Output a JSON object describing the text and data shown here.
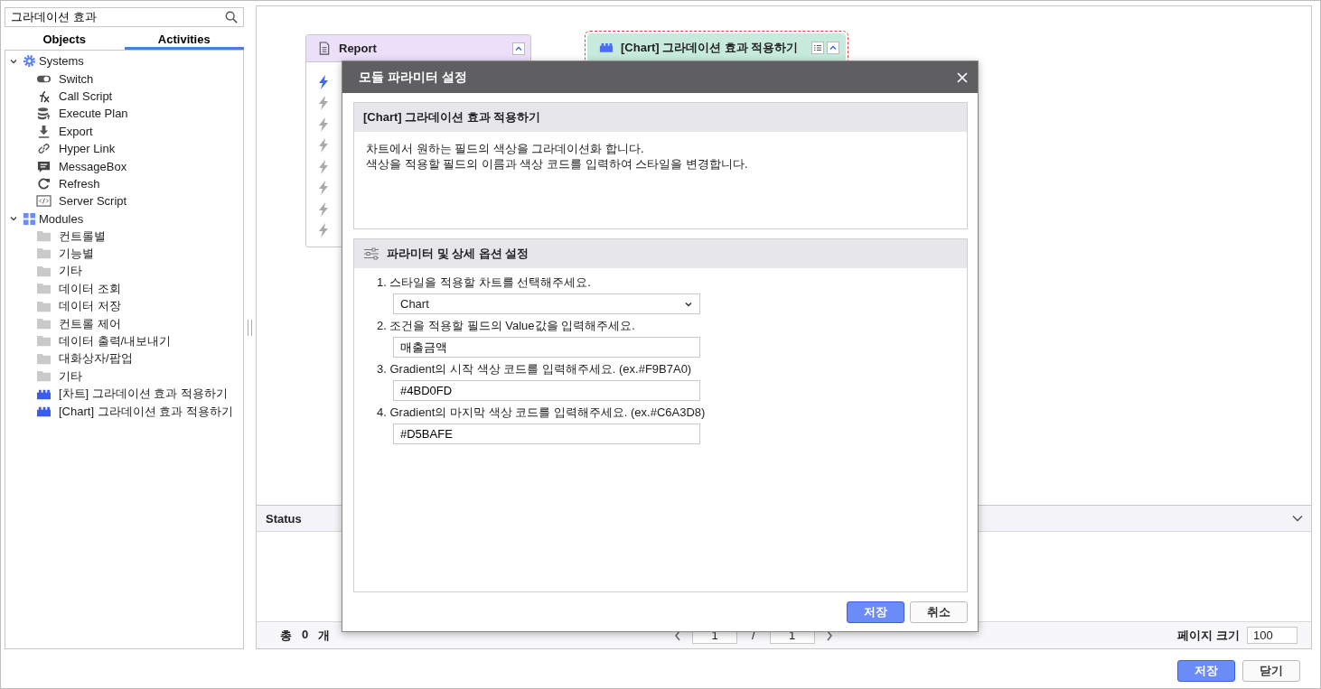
{
  "search": {
    "value": "그라데이션 효과"
  },
  "tabs": [
    {
      "label": "Objects",
      "selected": false
    },
    {
      "label": "Activities",
      "selected": true
    }
  ],
  "tree": [
    {
      "label": "Systems",
      "kind": "gear",
      "expanded": true,
      "children": [
        {
          "label": "Switch",
          "kind": "toggle"
        },
        {
          "label": "Call Script",
          "kind": "fx"
        },
        {
          "label": "Execute Plan",
          "kind": "database"
        },
        {
          "label": "Export",
          "kind": "download"
        },
        {
          "label": "Hyper Link",
          "kind": "link"
        },
        {
          "label": "MessageBox",
          "kind": "message"
        },
        {
          "label": "Refresh",
          "kind": "refresh"
        },
        {
          "label": "Server Script",
          "kind": "code"
        }
      ]
    },
    {
      "label": "Modules",
      "kind": "grid",
      "expanded": true,
      "children": [
        {
          "label": "컨트롤별",
          "kind": "folder"
        },
        {
          "label": "기능별",
          "kind": "folder"
        },
        {
          "label": "기타",
          "kind": "folder"
        },
        {
          "label": "데이터 조회",
          "kind": "folder"
        },
        {
          "label": "데이터 저장",
          "kind": "folder"
        },
        {
          "label": "컨트롤 제어",
          "kind": "folder"
        },
        {
          "label": "데이터 출력/내보내기",
          "kind": "folder"
        },
        {
          "label": "대화상자/팝업",
          "kind": "folder"
        },
        {
          "label": "기타",
          "kind": "folder"
        },
        {
          "label": "[차트] 그라데이션 효과 적용하기",
          "kind": "module"
        },
        {
          "label": "[Chart] 그라데이션 효과 적용하기",
          "kind": "module"
        }
      ]
    }
  ],
  "canvas": {
    "nodes": [
      {
        "kind": "report",
        "title": "Report",
        "selected": false,
        "items": [
          {
            "selected": true
          },
          {
            "selected": false
          },
          {
            "selected": false
          },
          {
            "selected": false
          },
          {
            "selected": false
          },
          {
            "selected": false
          },
          {
            "selected": false
          },
          {
            "selected": false
          }
        ]
      },
      {
        "kind": "module",
        "title": "[Chart] 그라데이션 효과 적용하기",
        "selected": true
      }
    ]
  },
  "status": {
    "title": "Status",
    "total_label": "총",
    "count": "0",
    "unit": "개",
    "page": "1",
    "separator": "/",
    "pages": "1",
    "page_size_label": "페이지 크기",
    "page_size": "100"
  },
  "dialog": {
    "title": "모듈 파라미터 설정",
    "module_title": "[Chart] 그라데이션 효과 적용하기",
    "description": [
      "차트에서 원하는 필드의 색상을 그라데이션화 합니다.",
      "색상을 적용할 필드의 이름과 색상 코드를 입력하여 스타일을 변경합니다."
    ],
    "params_title": "파라미터 및 상세 옵션 설정",
    "params": [
      {
        "kind": "select",
        "label": "1. 스타일을 적용할 차트를 선택해주세요.",
        "value": "Chart"
      },
      {
        "kind": "text",
        "label": "2. 조건을 적용할 필드의 Value값을 입력해주세요.",
        "value": "매출금액"
      },
      {
        "kind": "text",
        "label": "3. Gradient의 시작 색상 코드를 입력해주세요. (ex.#F9B7A0)",
        "value": "#4BD0FD"
      },
      {
        "kind": "text",
        "label": "4. Gradient의 마지막 색상 코드를 입력해주세요.  (ex.#C6A3D8)",
        "value": "#D5BAFE"
      }
    ],
    "buttons": [
      {
        "label": "저장",
        "kind": "primary"
      },
      {
        "label": "취소",
        "kind": "secondary"
      }
    ]
  },
  "buttons": [
    {
      "label": "저장",
      "kind": "primary"
    },
    {
      "label": "닫기",
      "kind": "secondary"
    }
  ]
}
